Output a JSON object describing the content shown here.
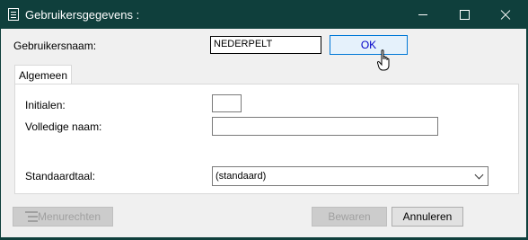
{
  "window": {
    "title": "Gebruikersgegevens :",
    "icon": "form-icon",
    "controls": [
      "minimize-icon",
      "maximize-icon",
      "close-icon"
    ]
  },
  "colors": {
    "titlebar": "#0f3f3c",
    "ok_border": "#0078d7",
    "ok_text": "#0000c8"
  },
  "username": {
    "label": "Gebruikersnaam:",
    "value": "NEDERPELT"
  },
  "ok_button": {
    "label": "OK"
  },
  "tabs": [
    {
      "label": "Algemeen",
      "active": true
    }
  ],
  "fields": {
    "initials": {
      "label": "Initialen:",
      "value": ""
    },
    "full_name": {
      "label": "Volledige naam:",
      "value": ""
    },
    "default_language": {
      "label": "Standaardtaal:",
      "value": "(standaard)"
    }
  },
  "footer": {
    "menu_rights": {
      "label": "Menurechten",
      "enabled": false
    },
    "save": {
      "label": "Bewaren",
      "enabled": false
    },
    "cancel": {
      "label": "Annuleren",
      "enabled": true
    }
  }
}
